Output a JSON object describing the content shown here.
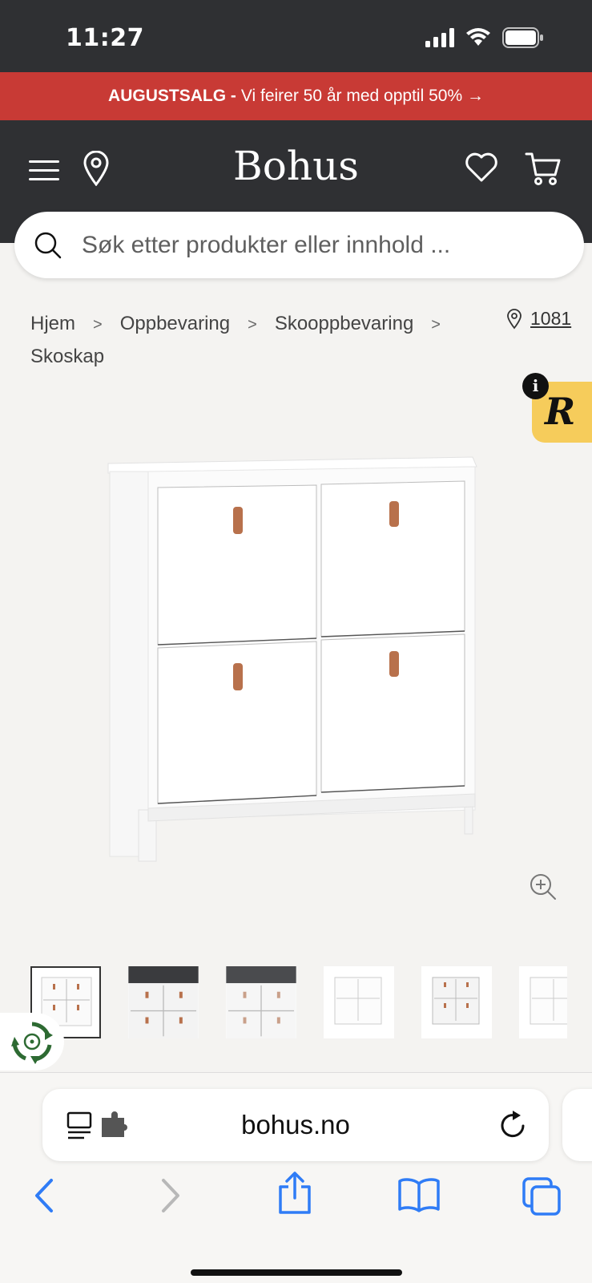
{
  "status_bar": {
    "time": "11:27"
  },
  "promo": {
    "bold": "AUGUSTSALG -",
    "text": "Vi feirer 50 år med opptil 50% →",
    "color": "#c83a35"
  },
  "header": {
    "logo": "Bohus",
    "background": "#2f3033"
  },
  "search": {
    "placeholder": "Søk etter produkter eller innhold ..."
  },
  "breadcrumb": {
    "items": [
      "Hjem",
      "Oppbevaring",
      "Skooppbevaring",
      "Skoskap"
    ],
    "store": "1081"
  },
  "badges": {
    "info": "i",
    "r_logo": "R"
  },
  "product": {
    "thumbnail_count": 6,
    "active_thumbnail": 1
  },
  "browser": {
    "url": "bohus.no"
  },
  "colors": {
    "accent_blue": "#2f7cf6",
    "handle_leather": "#b8714c",
    "badge_yellow": "#f6cc5b"
  }
}
